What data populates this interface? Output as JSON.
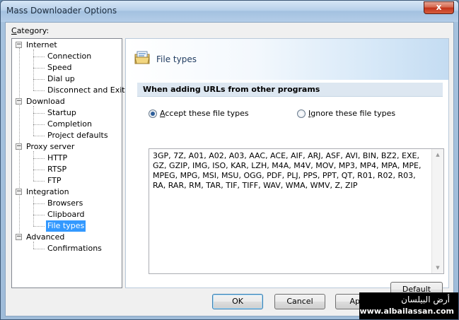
{
  "window": {
    "title": "Mass Downloader Options",
    "close_glyph": "x"
  },
  "category_label": "Category:",
  "tree": {
    "groups": [
      {
        "label": "Internet",
        "items": [
          "Connection",
          "Speed",
          "Dial up",
          "Disconnect and Exit"
        ]
      },
      {
        "label": "Download",
        "items": [
          "Startup",
          "Completion",
          "Project defaults"
        ]
      },
      {
        "label": "Proxy server",
        "items": [
          "HTTP",
          "RTSP",
          "FTP"
        ]
      },
      {
        "label": "Integration",
        "items": [
          "Browsers",
          "Clipboard",
          "File types"
        ]
      },
      {
        "label": "Advanced",
        "items": [
          "Confirmations"
        ]
      }
    ],
    "selected": "File types"
  },
  "panel": {
    "title": "File types",
    "section": "When adding URLs from other programs",
    "radio_accept": {
      "prefix": "",
      "underlined": "A",
      "rest": "ccept these file types",
      "checked": true
    },
    "radio_ignore": {
      "prefix": "",
      "underlined": "I",
      "rest": "gnore these file types",
      "checked": false
    },
    "file_types": "3GP, 7Z, A01, A02, A03, AAC, ACE, AIF, ARJ, ASF, AVI, BIN, BZ2, EXE, GZ, GZIP, IMG, ISO, KAR, LZH, M4A, M4V, MOV, MP3, MP4, MPA, MPE, MPEG, MPG, MSI, MSU, OGG, PDF, PLJ, PPS, PPT, QT, R01, R02, R03, RA, RAR, RM, TAR, TIF, TIFF, WAV, WMA, WMV, Z, ZIP",
    "default_types_button": "Default types"
  },
  "buttons": {
    "ok": "OK",
    "cancel": "Cancel",
    "apply": "Apply"
  },
  "watermark": {
    "arabic": "أرض البيلسان",
    "url": "www.albailassan.com"
  }
}
